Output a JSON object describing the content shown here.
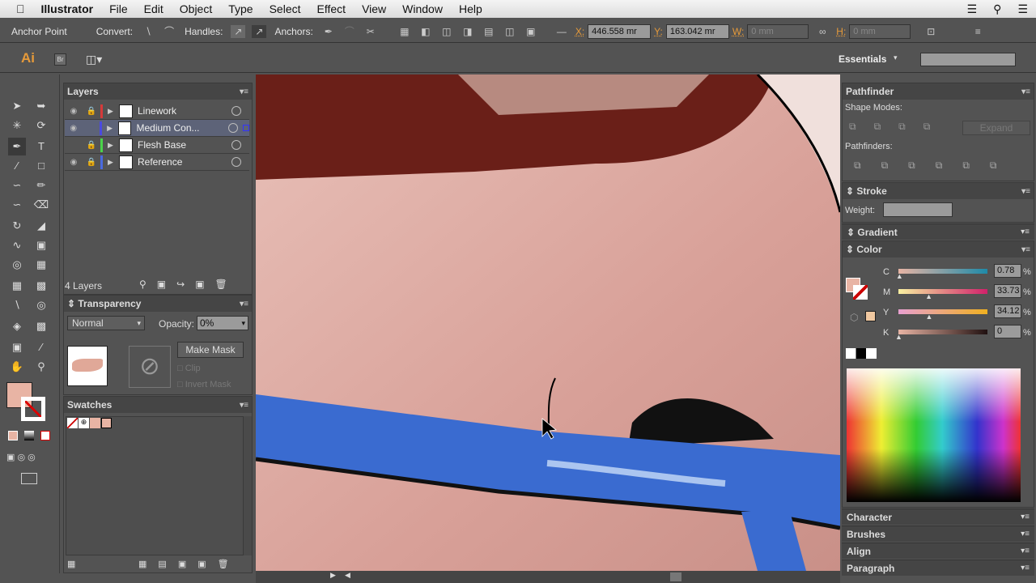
{
  "menubar": {
    "app": "Illustrator",
    "items": [
      "File",
      "Edit",
      "Object",
      "Type",
      "Select",
      "Effect",
      "View",
      "Window",
      "Help"
    ]
  },
  "control": {
    "tool": "Anchor Point",
    "convert": "Convert:",
    "handles": "Handles:",
    "anchors": "Anchors:",
    "x_label": "X:",
    "x": "446.558 mr",
    "y_label": "Y:",
    "y": "163.042 mr",
    "w_label": "W:",
    "w": "0 mm",
    "h_label": "H:",
    "h": "0 mm"
  },
  "appbar": {
    "logo": "Ai",
    "bridge": "Br",
    "workspace": "Essentials",
    "search_placeholder": ""
  },
  "layers": {
    "title": "Layers",
    "items": [
      {
        "name": "Linework",
        "color": "#d63a3a",
        "visible": true,
        "locked": true
      },
      {
        "name": "Medium Con...",
        "color": "#4a4ae0",
        "visible": true,
        "locked": false,
        "selected": true
      },
      {
        "name": "Flesh Base",
        "color": "#4ad44a",
        "visible": false,
        "locked": true
      },
      {
        "name": "Reference",
        "color": "#4a6ae0",
        "visible": true,
        "locked": true
      }
    ],
    "count": "4 Layers"
  },
  "transparency": {
    "title": "Transparency",
    "blend": "Normal",
    "opacity_label": "Opacity:",
    "opacity": "0%",
    "make_mask": "Make Mask",
    "clip": "Clip",
    "invert": "Invert Mask"
  },
  "swatches": {
    "title": "Swatches"
  },
  "pathfinder": {
    "title": "Pathfinder",
    "shape_modes": "Shape Modes:",
    "expand": "Expand",
    "pathfinders": "Pathfinders:"
  },
  "stroke": {
    "title": "Stroke",
    "weight_label": "Weight:"
  },
  "gradient": {
    "title": "Gradient"
  },
  "color": {
    "title": "Color",
    "fill": "#e8b4a4",
    "channels": [
      {
        "label": "C",
        "value": "0.78",
        "level": 0.78
      },
      {
        "label": "M",
        "value": "33.73",
        "level": 33.73
      },
      {
        "label": "Y",
        "value": "34.12",
        "level": 34.12
      },
      {
        "label": "K",
        "value": "0",
        "level": 0
      }
    ],
    "pct": "%"
  },
  "collapsed": [
    "Character",
    "Brushes",
    "Align",
    "Paragraph"
  ]
}
